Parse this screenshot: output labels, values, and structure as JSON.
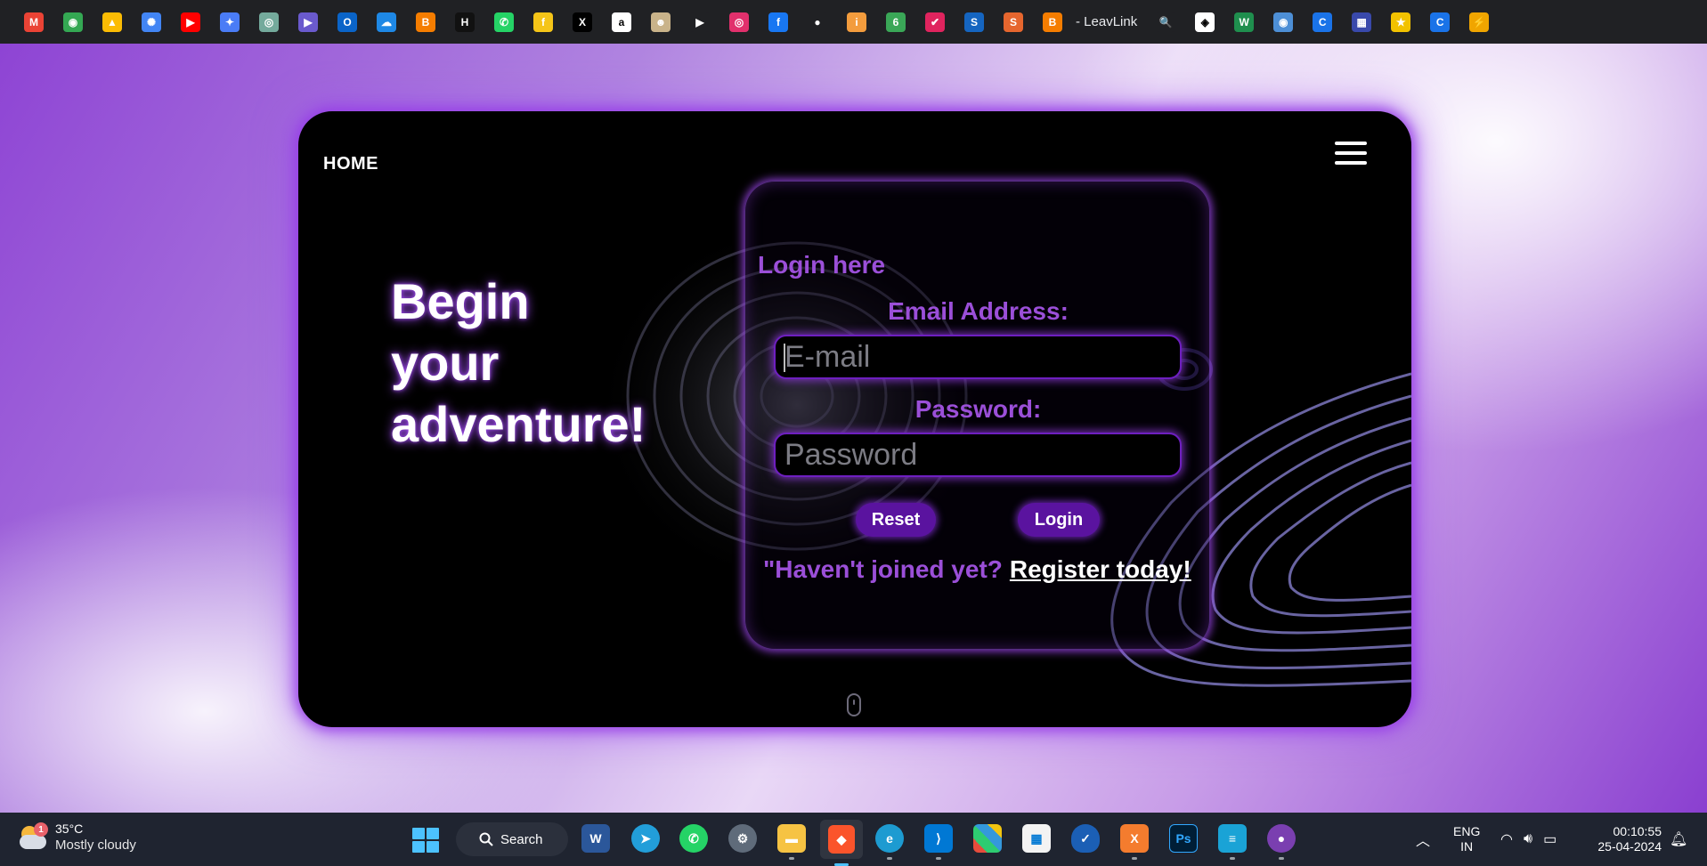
{
  "bookmarks": {
    "items": [
      {
        "name": "gmail",
        "glyph": "M",
        "color": "#ea4335"
      },
      {
        "name": "maps",
        "glyph": "◉",
        "color": "#34a853"
      },
      {
        "name": "drive",
        "glyph": "▲",
        "color": "#fbbc04"
      },
      {
        "name": "photos",
        "glyph": "✺",
        "color": "#4285f4"
      },
      {
        "name": "youtube",
        "glyph": "▶",
        "color": "#ff0000"
      },
      {
        "name": "gemini",
        "glyph": "✦",
        "color": "#4a7cf6"
      },
      {
        "name": "chatgpt",
        "glyph": "◎",
        "color": "#74aa9c"
      },
      {
        "name": "copilot",
        "glyph": "▶",
        "color": "#6a5acd"
      },
      {
        "name": "outlook",
        "glyph": "O",
        "color": "#0a64c8"
      },
      {
        "name": "onedrive",
        "glyph": "☁",
        "color": "#1e88e5"
      },
      {
        "name": "blogger",
        "glyph": "B",
        "color": "#f57d00"
      },
      {
        "name": "hashnode",
        "glyph": "H",
        "color": "#111111"
      },
      {
        "name": "whatsapp",
        "glyph": "✆",
        "color": "#25d366"
      },
      {
        "name": "flipkart",
        "glyph": "f",
        "color": "#f5c518"
      },
      {
        "name": "x",
        "glyph": "X",
        "color": "#000000"
      },
      {
        "name": "amazon",
        "glyph": "a",
        "color": "#ffffff"
      },
      {
        "name": "mask",
        "glyph": "☻",
        "color": "#c9b38a"
      },
      {
        "name": "play",
        "glyph": "▶",
        "color": "#202124"
      },
      {
        "name": "instagram",
        "glyph": "◎",
        "color": "#e1306c"
      },
      {
        "name": "facebook",
        "glyph": "f",
        "color": "#1877f2"
      },
      {
        "name": "github",
        "glyph": "●",
        "color": "#202124"
      },
      {
        "name": "info",
        "glyph": "i",
        "color": "#f39c3d"
      },
      {
        "name": "leaf",
        "glyph": "6",
        "color": "#3aa757"
      },
      {
        "name": "bookmark-pink",
        "glyph": "✔",
        "color": "#e0245e"
      },
      {
        "name": "s-blue",
        "glyph": "S",
        "color": "#1565c0"
      },
      {
        "name": "s-orange",
        "glyph": "S",
        "color": "#e6662e"
      },
      {
        "name": "blogger-leavlink",
        "glyph": "B",
        "color": "#f57d00"
      }
    ],
    "leavlink_label": "- LeavLink",
    "items_after": [
      {
        "name": "search",
        "glyph": "🔍",
        "color": "#202124"
      },
      {
        "name": "codepen",
        "glyph": "◈",
        "color": "#ffffff"
      },
      {
        "name": "w-green",
        "glyph": "W",
        "color": "#1f8f4e"
      },
      {
        "name": "gpt-circle",
        "glyph": "◉",
        "color": "#4d8fd6"
      },
      {
        "name": "c-blue-1",
        "glyph": "C",
        "color": "#1a73e8"
      },
      {
        "name": "grid-blue",
        "glyph": "▦",
        "color": "#3949ab"
      },
      {
        "name": "star-yellow",
        "glyph": "★",
        "color": "#f2c200"
      },
      {
        "name": "c-blue-2",
        "glyph": "C",
        "color": "#1a73e8"
      },
      {
        "name": "lightning",
        "glyph": "⚡",
        "color": "#f0a500"
      }
    ]
  },
  "card": {
    "home_label": "HOME",
    "headline": [
      "Begin",
      "your",
      "adventure!"
    ],
    "login": {
      "title": "Login here",
      "email_label": "Email Address:",
      "email_placeholder": "E-mail",
      "password_label": "Password:",
      "password_placeholder": "Password",
      "reset_label": "Reset",
      "login_label": "Login",
      "register_prompt": "\"Haven't joined yet?",
      "register_link": "Register today!"
    }
  },
  "taskbar": {
    "weather": {
      "temp": "35°C",
      "condition": "Mostly cloudy",
      "badge": "1"
    },
    "search_label": "Search",
    "lang_top": "ENG",
    "lang_bottom": "IN",
    "time": "00:10:55",
    "date": "25-04-2024"
  },
  "colors": {
    "accent": "#9b4fd8",
    "button": "#5a139f",
    "glow": "#a050f0"
  }
}
